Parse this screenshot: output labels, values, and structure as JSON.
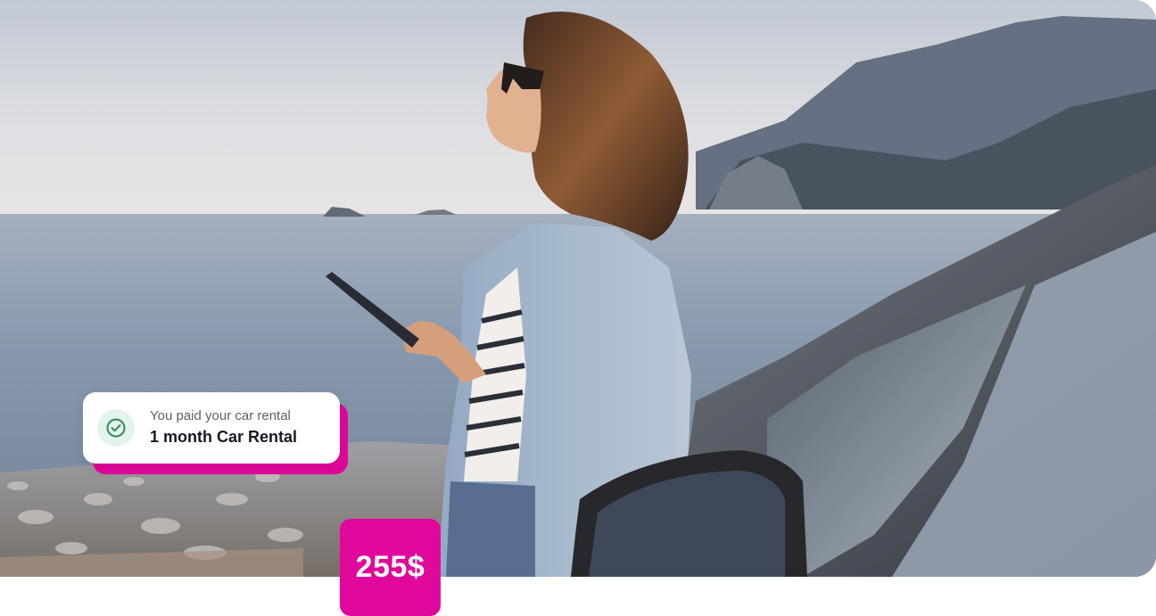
{
  "photo": {
    "icon": "woman-by-car-sea-photo"
  },
  "notification": {
    "icon": "check-circle-icon",
    "subtitle": "You paid your car rental",
    "title": "1 month Car Rental",
    "accent_color": "#e0079b",
    "check_color": "#2e8b57"
  },
  "price": {
    "label": "255$",
    "color": "#e0079b"
  }
}
